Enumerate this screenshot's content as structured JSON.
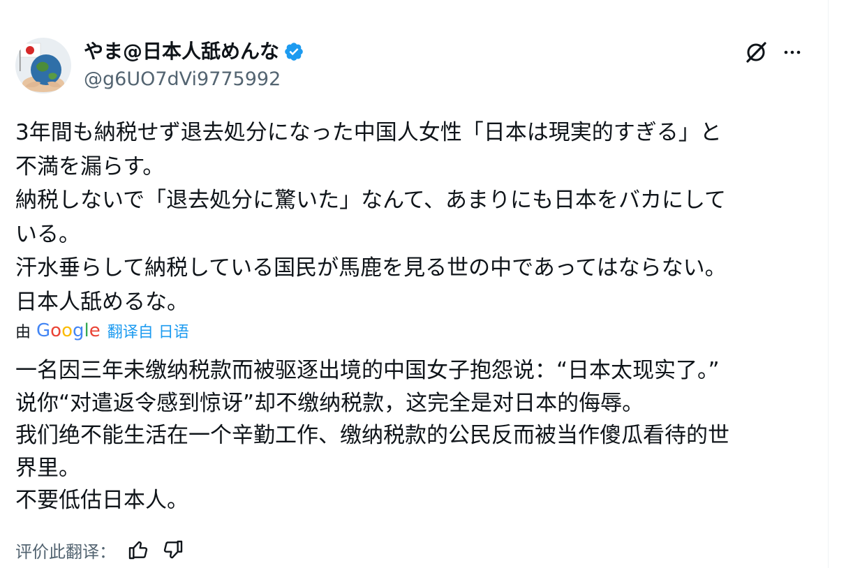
{
  "author": {
    "display_name": "やま@日本人舐めんな",
    "handle": "@g6UO7dVi9775992"
  },
  "tweet": {
    "original_lines": [
      "3年間も納税せず退去処分になった中国人女性「日本は現実的すぎる」と",
      "不満を漏らす。",
      "納税しないで「退去処分に驚いた」なんて、あまりにも日本をバカにして",
      "いる。",
      "汗水垂らして納税している国民が馬鹿を見る世の中であってはならない。",
      "日本人舐めるな。"
    ],
    "translation": {
      "by_label": "由",
      "google_letters": [
        "G",
        "o",
        "o",
        "g",
        "l",
        "e"
      ],
      "google_colors": [
        "#4285F4",
        "#EA4335",
        "#FBBC05",
        "#4285F4",
        "#34A853",
        "#EA4335"
      ],
      "translated_from": "翻译自 日语",
      "lines": [
        "一名因三年未缴纳税款而被驱逐出境的中国女子抱怨说：“日本太现实了。”",
        "说你“对遣返令感到惊讶”却不缴纳税款，这完全是对日本的侮辱。",
        "我们绝不能生活在一个辛勤工作、缴纳税款的公民反而被当作傻瓜看待的世",
        "界里。",
        "不要低估日本人。"
      ]
    },
    "rate_label": "评价此翻译："
  },
  "icons": {
    "verified": "verified-badge-icon",
    "grok": "grok-icon",
    "more": "more-icon",
    "thumbs_up": "thumbs-up-icon",
    "thumbs_down": "thumbs-down-icon"
  },
  "colors": {
    "text": "#0f1419",
    "secondary": "#536471",
    "link": "#1d9bf0",
    "verified": "#1d9bf0"
  }
}
